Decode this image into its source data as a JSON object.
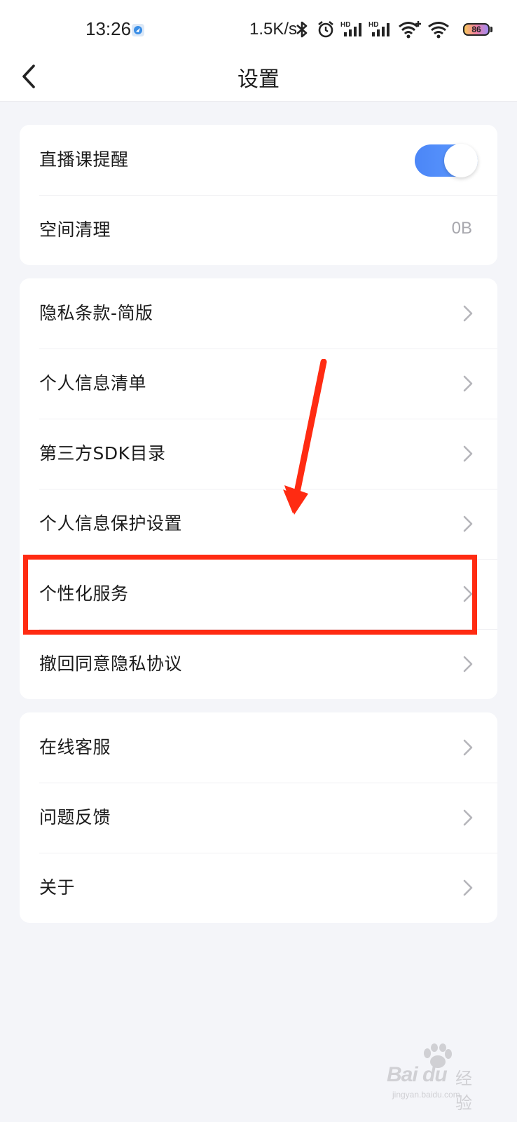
{
  "status_bar": {
    "time": "13:26",
    "network_speed": "1.5K/s",
    "battery_level": "86",
    "icons": [
      "location-app-icon",
      "bluetooth-icon",
      "alarm-icon",
      "hd-signal-icon",
      "hd-signal-icon",
      "wifi-plus-icon",
      "wifi-icon",
      "battery-icon"
    ]
  },
  "header": {
    "title": "设置",
    "back_icon": "chevron-left-icon"
  },
  "group1": {
    "live_reminder": {
      "label": "直播课提醒",
      "toggle_on": true
    },
    "storage_cleanup": {
      "label": "空间清理",
      "value": "0B"
    }
  },
  "group2": {
    "items": [
      {
        "label": "隐私条款-简版"
      },
      {
        "label": "个人信息清单"
      },
      {
        "label": "第三方SDK目录"
      },
      {
        "label": "个人信息保护设置"
      },
      {
        "label": "个性化服务"
      },
      {
        "label": "撤回同意隐私协议"
      }
    ]
  },
  "group3": {
    "items": [
      {
        "label": "在线客服"
      },
      {
        "label": "问题反馈"
      },
      {
        "label": "关于"
      }
    ]
  },
  "annotation": {
    "arrow_color": "#ff2b12",
    "highlight_color": "#ff2b12",
    "highlighted_item": "个性化服务"
  },
  "watermark": {
    "brand": "Bai du",
    "brand_cn": "经验",
    "url": "jingyan.baidu.com"
  },
  "colors": {
    "accent": "#4b86f7",
    "background": "#f4f5f9",
    "card": "#ffffff"
  }
}
